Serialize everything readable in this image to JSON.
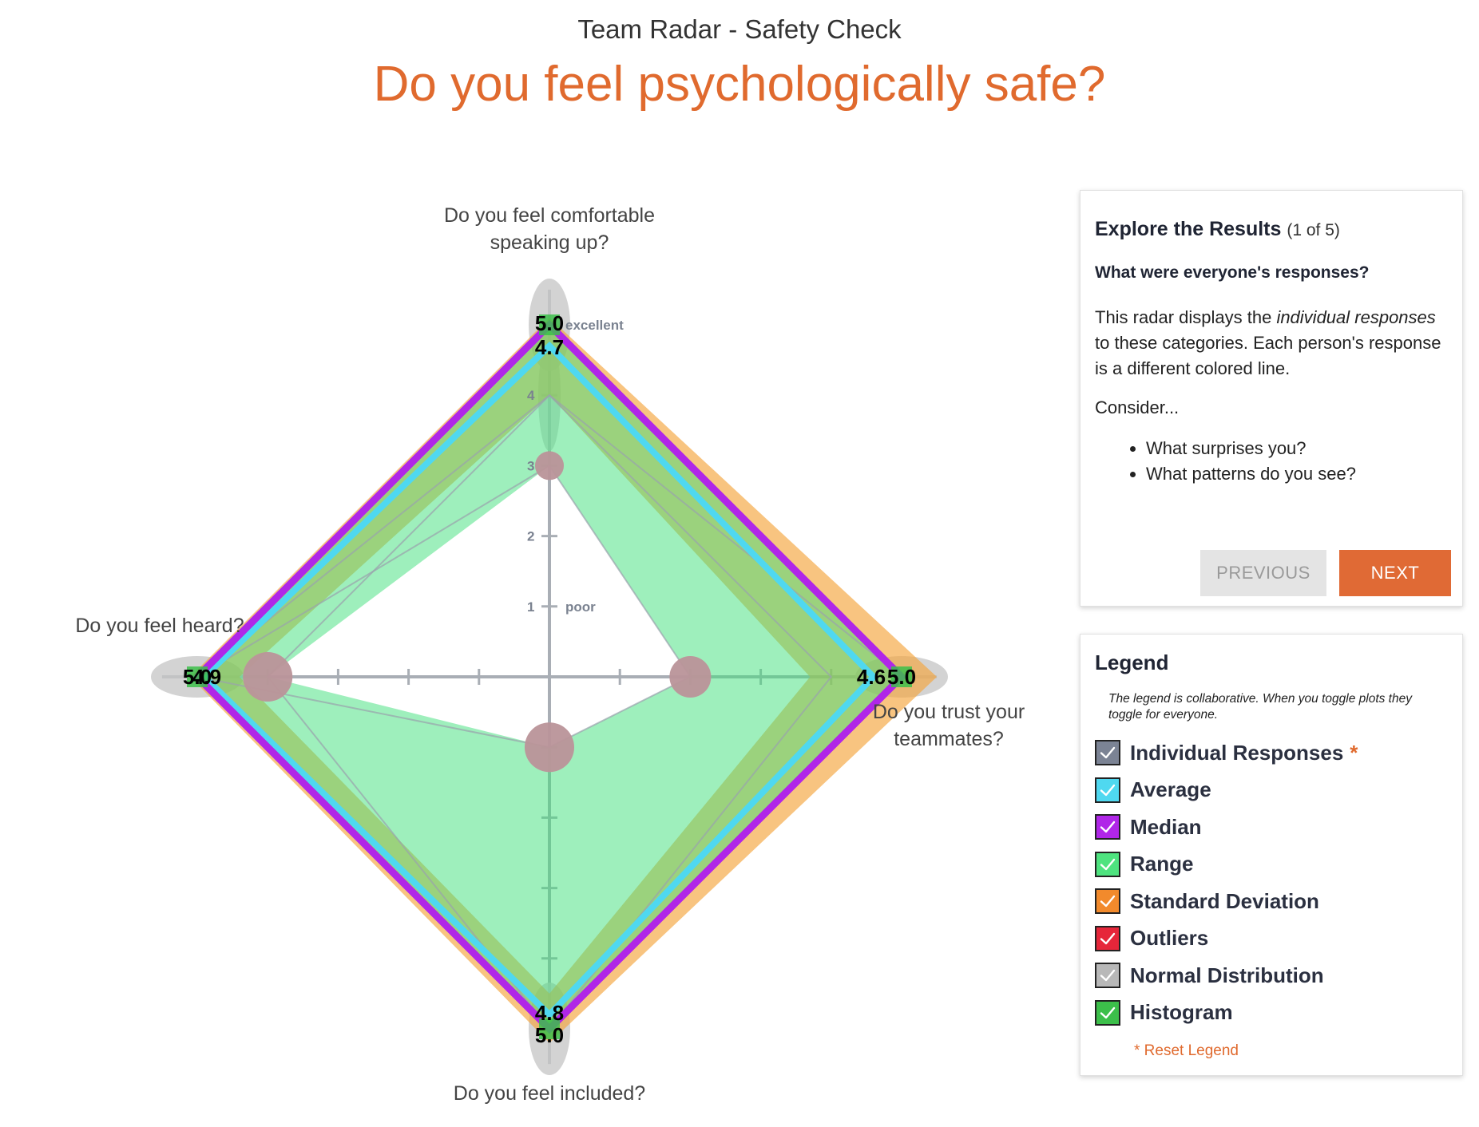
{
  "header": {
    "app_title": "Team Radar - Safety Check",
    "question": "Do you feel psychologically safe?"
  },
  "chart_data": {
    "type": "radar",
    "axes": [
      {
        "label_lines": [
          "Do you feel comfortable",
          "speaking up?"
        ],
        "direction": "up"
      },
      {
        "label_lines": [
          "Do you trust your",
          "teammates?"
        ],
        "direction": "right"
      },
      {
        "label_lines": [
          "Do you feel included?"
        ],
        "direction": "down"
      },
      {
        "label_lines": [
          "Do you feel heard?"
        ],
        "direction": "left"
      }
    ],
    "range": [
      0,
      5
    ],
    "ticks": [
      {
        "value": 1,
        "label": "1",
        "note": "poor"
      },
      {
        "value": 2,
        "label": "2",
        "note": ""
      },
      {
        "value": 3,
        "label": "3",
        "note": ""
      },
      {
        "value": 4,
        "label": "4",
        "note": ""
      },
      {
        "value": 5,
        "label": "",
        "note": "excellent"
      }
    ],
    "series": [
      {
        "name": "Standard Deviation",
        "kind": "band",
        "color": "#f5a43c",
        "lower": [
          4.0,
          3.7,
          4.5,
          4.4
        ],
        "upper": [
          5.1,
          5.5,
          5.2,
          5.1
        ]
      },
      {
        "name": "Range",
        "kind": "band",
        "color": "#3ee07a",
        "lower": [
          3.0,
          2.0,
          1.0,
          4.0
        ],
        "upper": [
          5.0,
          5.0,
          5.0,
          5.0
        ]
      },
      {
        "name": "Average",
        "kind": "line",
        "color": "#4fd8f0",
        "values": [
          4.7,
          4.6,
          4.8,
          4.9
        ]
      },
      {
        "name": "Median",
        "kind": "line",
        "color": "#b026e8",
        "values": [
          5.0,
          5.0,
          5.0,
          5.0
        ]
      },
      {
        "name": "Individual Responses",
        "kind": "individual",
        "color": "#9aa3ad",
        "values": [
          [
            5,
            5,
            5,
            5
          ],
          [
            4,
            4,
            5,
            5
          ],
          [
            3,
            2,
            1,
            5
          ],
          [
            4,
            5,
            5,
            4
          ]
        ]
      }
    ],
    "outliers": [
      {
        "axis": 0,
        "value": 3.0,
        "r": 18
      },
      {
        "axis": 1,
        "value": 2.0,
        "r": 26
      },
      {
        "axis": 2,
        "value": 1.0,
        "r": 31
      },
      {
        "axis": 3,
        "value": 4.0,
        "r": 31
      }
    ],
    "value_labels": [
      {
        "axis": 0,
        "texts": [
          "5.0",
          "4.7"
        ]
      },
      {
        "axis": 1,
        "texts": [
          "4.6",
          "5.0"
        ]
      },
      {
        "axis": 2,
        "texts": [
          "4.8",
          "5.0"
        ]
      },
      {
        "axis": 3,
        "texts": [
          "5.0",
          "4.9"
        ]
      }
    ]
  },
  "explore": {
    "title": "Explore the Results",
    "count": "(1 of 5)",
    "question": "What were everyone's responses?",
    "p1": "This radar displays the ",
    "p1_em": "individual responses",
    "p1_rest": " to these categories. Each person's response is a different colored line.",
    "consider": "Consider...",
    "bullets": [
      "What surprises you?",
      "What patterns do you see?"
    ],
    "prev_label": "PREVIOUS",
    "next_label": "NEXT"
  },
  "legend": {
    "title": "Legend",
    "note": "The legend is collaborative. When you toggle plots they toggle for everyone.",
    "items": [
      {
        "label": "Individual Responses",
        "color": "#7b8394",
        "star": "*"
      },
      {
        "label": "Average",
        "color": "#4fd8f0",
        "star": ""
      },
      {
        "label": "Median",
        "color": "#b026e8",
        "star": ""
      },
      {
        "label": "Range",
        "color": "#4ee37f",
        "star": ""
      },
      {
        "label": "Standard Deviation",
        "color": "#f28a2c",
        "star": ""
      },
      {
        "label": "Outliers",
        "color": "#e6263a",
        "star": ""
      },
      {
        "label": "Normal Distribution",
        "color": "#b8b8b8",
        "star": ""
      },
      {
        "label": "Histogram",
        "color": "#3cbf4a",
        "star": ""
      }
    ],
    "reset_label": "* Reset Legend"
  }
}
